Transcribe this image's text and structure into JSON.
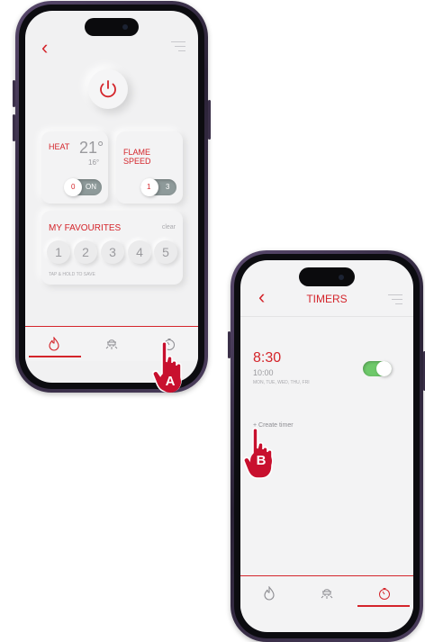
{
  "colors": {
    "accent": "#d4252b",
    "toggle_on": "#6ec96a",
    "toggle_off": "#8e9a9a",
    "badge": "#c8102e"
  },
  "screen_a": {
    "back_icon": "‹",
    "menu_icon": "hamburger-icon",
    "power_icon": "power-icon",
    "heat": {
      "label": "HEAT",
      "temp": "21°",
      "target": "16°",
      "toggle_off": "0",
      "toggle_on": "ON"
    },
    "flame": {
      "label_line1": "FLAME",
      "label_line2": "SPEED",
      "toggle_left": "1",
      "toggle_right": "3"
    },
    "favourites": {
      "title": "MY FAVOURITES",
      "clear": "clear",
      "slots": [
        "1",
        "2",
        "3",
        "4",
        "5"
      ],
      "hint": "TAP & HOLD TO SAVE"
    },
    "tabs": [
      "flame-icon",
      "fireplace-icon",
      "timer-icon"
    ],
    "active_tab": 0
  },
  "screen_b": {
    "back_icon": "‹",
    "title": "TIMERS",
    "timer": {
      "start": "8:30",
      "end": "10:00",
      "days": "MON, TUE, WED, THU, FRI",
      "enabled": true
    },
    "create": "+ Create timer",
    "tabs": [
      "flame-icon",
      "fireplace-icon",
      "timer-icon"
    ],
    "active_tab": 2
  },
  "markers": {
    "a": "A",
    "b": "B"
  }
}
